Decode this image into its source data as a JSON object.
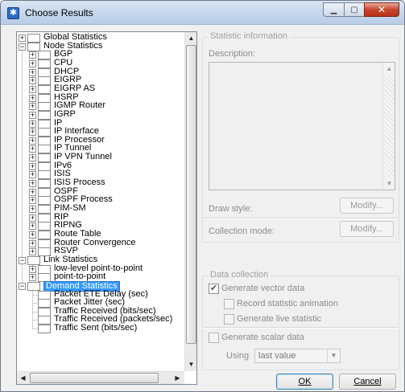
{
  "window": {
    "title": "Choose Results"
  },
  "tree": {
    "rows": [
      {
        "label": "Global Statistics",
        "level": 0,
        "expander": "+"
      },
      {
        "label": "Node Statistics",
        "level": 0,
        "expander": "−"
      },
      {
        "label": "BGP",
        "level": 1,
        "expander": "+"
      },
      {
        "label": "CPU",
        "level": 1,
        "expander": "+"
      },
      {
        "label": "DHCP",
        "level": 1,
        "expander": "+"
      },
      {
        "label": "EIGRP",
        "level": 1,
        "expander": "+"
      },
      {
        "label": "EIGRP AS",
        "level": 1,
        "expander": "+"
      },
      {
        "label": "HSRP",
        "level": 1,
        "expander": "+"
      },
      {
        "label": "IGMP Router",
        "level": 1,
        "expander": "+"
      },
      {
        "label": "IGRP",
        "level": 1,
        "expander": "+"
      },
      {
        "label": "IP",
        "level": 1,
        "expander": "+"
      },
      {
        "label": "IP Interface",
        "level": 1,
        "expander": "+"
      },
      {
        "label": "IP Processor",
        "level": 1,
        "expander": "+"
      },
      {
        "label": "IP Tunnel",
        "level": 1,
        "expander": "+"
      },
      {
        "label": "IP VPN Tunnel",
        "level": 1,
        "expander": "+"
      },
      {
        "label": "IPv6",
        "level": 1,
        "expander": "+"
      },
      {
        "label": "ISIS",
        "level": 1,
        "expander": "+"
      },
      {
        "label": "ISIS Process",
        "level": 1,
        "expander": "+"
      },
      {
        "label": "OSPF",
        "level": 1,
        "expander": "+"
      },
      {
        "label": "OSPF Process",
        "level": 1,
        "expander": "+"
      },
      {
        "label": "PIM-SM",
        "level": 1,
        "expander": "+"
      },
      {
        "label": "RIP",
        "level": 1,
        "expander": "+"
      },
      {
        "label": "RIPNG",
        "level": 1,
        "expander": "+"
      },
      {
        "label": "Route Table",
        "level": 1,
        "expander": "+"
      },
      {
        "label": "Router Convergence",
        "level": 1,
        "expander": "+"
      },
      {
        "label": "RSVP",
        "level": 1,
        "expander": "+"
      },
      {
        "label": "Link Statistics",
        "level": 0,
        "expander": "−"
      },
      {
        "label": "low-level point-to-point",
        "level": 1,
        "expander": "+"
      },
      {
        "label": "point-to-point",
        "level": 1,
        "expander": "+"
      },
      {
        "label": "Demand Statistics",
        "level": 0,
        "expander": "−",
        "selected": true
      },
      {
        "label": "Packet ETE Delay (sec)",
        "level": 1,
        "expander": ""
      },
      {
        "label": "Packet Jitter (sec)",
        "level": 1,
        "expander": ""
      },
      {
        "label": "Traffic Received (bits/sec)",
        "level": 1,
        "expander": ""
      },
      {
        "label": "Traffic Received (packets/sec)",
        "level": 1,
        "expander": ""
      },
      {
        "label": "Traffic Sent (bits/sec)",
        "level": 1,
        "expander": ""
      }
    ]
  },
  "statistic_info": {
    "group_title": "Statistic information",
    "description_label": "Description:",
    "draw_style_label": "Draw style:",
    "draw_style_button": "Modify...",
    "collection_mode_label": "Collection mode:",
    "collection_mode_button": "Modify..."
  },
  "data_collection": {
    "group_title": "Data collection",
    "generate_vector": "Generate vector data",
    "record_animation": "Record statistic animation",
    "generate_live": "Generate live statistic",
    "generate_scalar": "Generate scalar data",
    "using_label": "Using",
    "using_value": "last value"
  },
  "footer": {
    "ok_label": "OK",
    "cancel_label": "Cancel"
  }
}
